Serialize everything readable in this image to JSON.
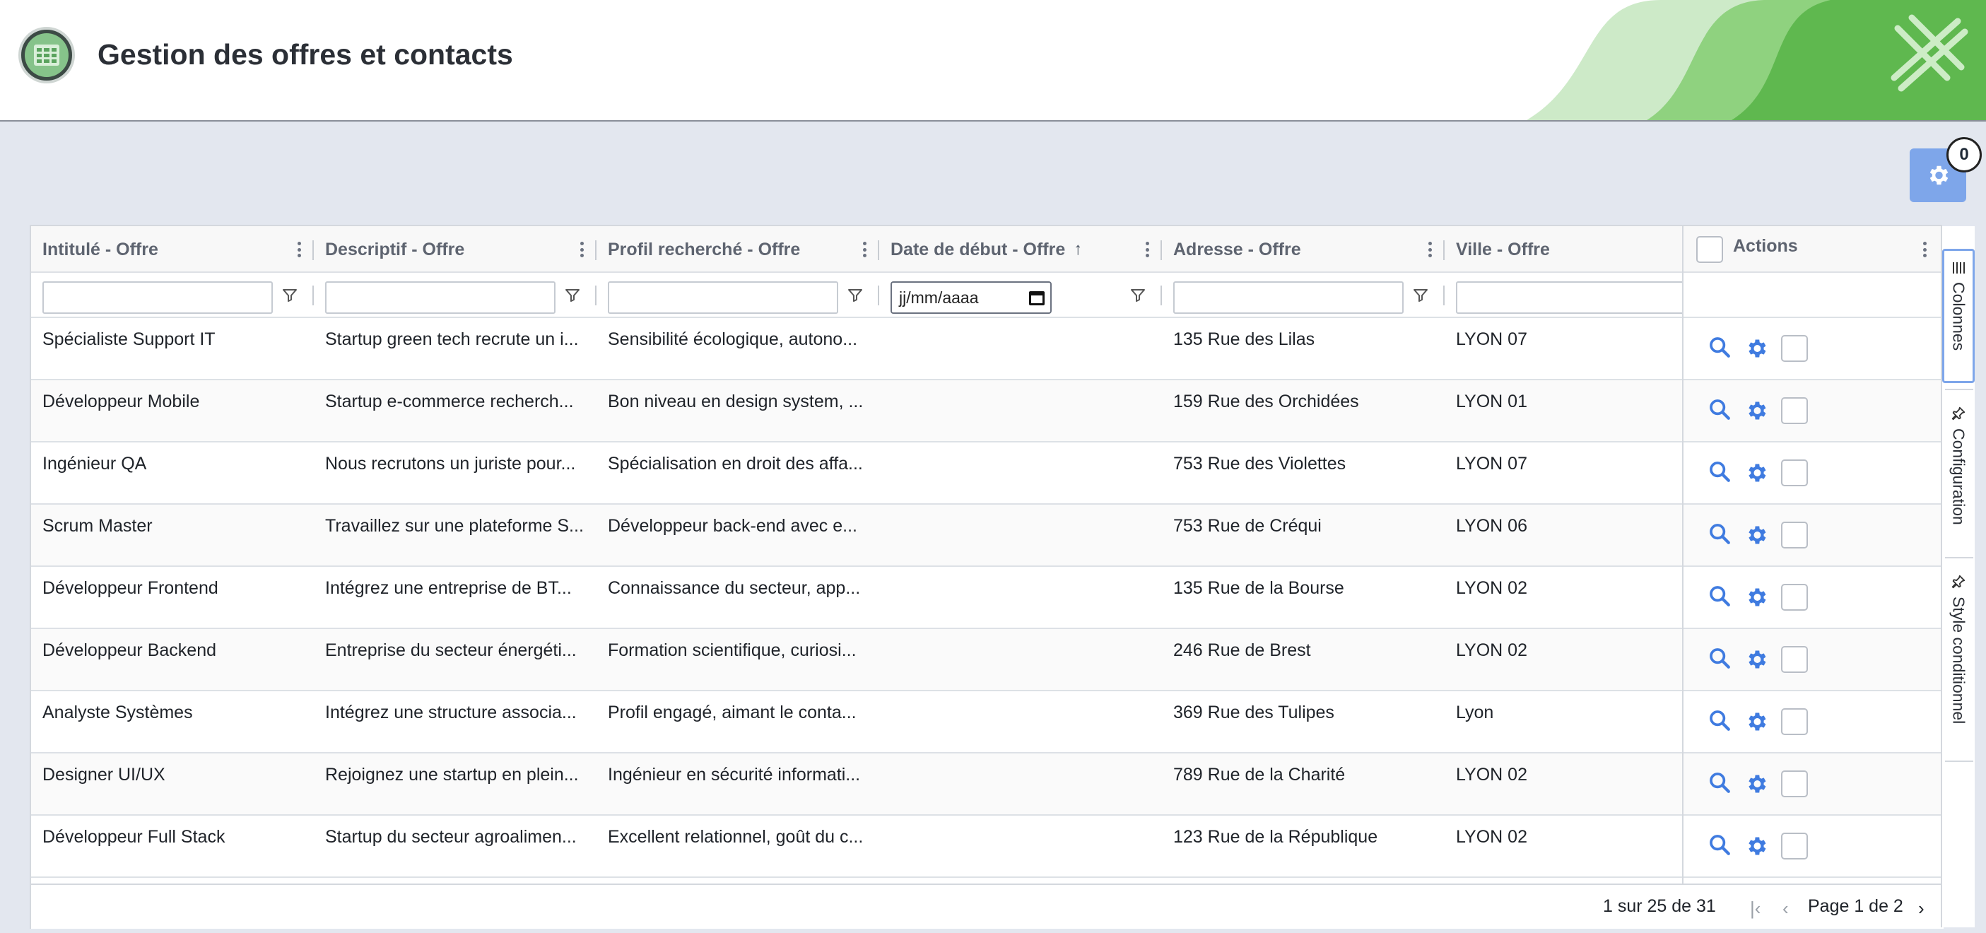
{
  "header": {
    "title": "Gestion des offres et contacts"
  },
  "settings_badge": "0",
  "columns": [
    {
      "label": "Intitulé - Offre"
    },
    {
      "label": "Descriptif - Offre"
    },
    {
      "label": "Profil recherché - Offre"
    },
    {
      "label": "Date de début - Offre",
      "sort": "↑"
    },
    {
      "label": "Adresse - Offre"
    },
    {
      "label": "Ville - Offre"
    }
  ],
  "filters": {
    "date_placeholder": "jj/mm/aaaa"
  },
  "actions_header": "Actions",
  "rows": [
    {
      "intitule": "Spécialiste Support IT",
      "descriptif": "Startup green tech recrute un i...",
      "profil": "Sensibilité écologique, autono...",
      "date": "",
      "adresse": "135 Rue des Lilas",
      "ville": "LYON 07"
    },
    {
      "intitule": "Développeur Mobile",
      "descriptif": "Startup e-commerce recherch...",
      "profil": "Bon niveau en design system, ...",
      "date": "",
      "adresse": "159 Rue des Orchidées",
      "ville": "LYON 01"
    },
    {
      "intitule": "Ingénieur QA",
      "descriptif": "Nous recrutons un juriste pour...",
      "profil": "Spécialisation en droit des affa...",
      "date": "",
      "adresse": "753 Rue des Violettes",
      "ville": "LYON 07"
    },
    {
      "intitule": "Scrum Master",
      "descriptif": "Travaillez sur une plateforme S...",
      "profil": "Développeur back-end avec e...",
      "date": "",
      "adresse": "753 Rue de Créqui",
      "ville": "LYON 06"
    },
    {
      "intitule": "Développeur Frontend",
      "descriptif": "Intégrez une entreprise de BT...",
      "profil": "Connaissance du secteur, app...",
      "date": "",
      "adresse": "135 Rue de la Bourse",
      "ville": "LYON 02"
    },
    {
      "intitule": "Développeur Backend",
      "descriptif": "Entreprise du secteur énergéti...",
      "profil": "Formation scientifique, curiosi...",
      "date": "",
      "adresse": "246 Rue de Brest",
      "ville": "LYON 02"
    },
    {
      "intitule": "Analyste Systèmes",
      "descriptif": "Intégrez une structure associa...",
      "profil": "Profil engagé, aimant le conta...",
      "date": "",
      "adresse": "369 Rue des Tulipes",
      "ville": "Lyon"
    },
    {
      "intitule": "Designer UI/UX",
      "descriptif": "Rejoignez une startup en plein...",
      "profil": "Ingénieur en sécurité informati...",
      "date": "",
      "adresse": "789 Rue de la Charité",
      "ville": "LYON 02"
    },
    {
      "intitule": "Développeur Full Stack",
      "descriptif": "Startup du secteur agroalimen...",
      "profil": "Excellent relationnel, goût du c...",
      "date": "",
      "adresse": "123 Rue de la République",
      "ville": "LYON 02"
    }
  ],
  "side_tabs": [
    "Colonnes",
    "Configuration",
    "Style conditionnel"
  ],
  "pagination": {
    "summary": "1 sur 25 de 31",
    "page_label": "Page 1 de 2"
  },
  "colors": {
    "accent": "#7ea6ea",
    "icon_blue": "#3f7be0",
    "header_green": "#5db85a"
  }
}
